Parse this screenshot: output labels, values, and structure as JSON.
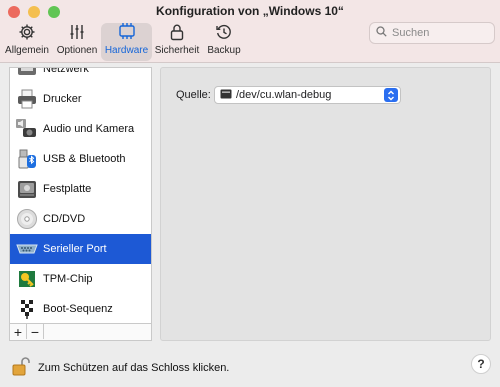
{
  "window": {
    "title": "Konfiguration von „Windows 10“",
    "traffic_colors": [
      "#ff5f57",
      "#febc2e",
      "#28c840"
    ]
  },
  "toolbar": {
    "items": [
      {
        "label": "Allgemein",
        "icon": "gear-icon"
      },
      {
        "label": "Optionen",
        "icon": "sliders-icon"
      },
      {
        "label": "Hardware",
        "icon": "hardware-chip-icon",
        "active": true
      },
      {
        "label": "Sicherheit",
        "icon": "lock-icon"
      },
      {
        "label": "Backup",
        "icon": "clock-history-icon"
      }
    ],
    "accent_color": "#1565d8"
  },
  "search": {
    "placeholder": "Suchen",
    "icon": "search-icon"
  },
  "sidebar": {
    "items": [
      {
        "label": "Netzwerk",
        "icon": "network-icon"
      },
      {
        "label": "Drucker",
        "icon": "printer-icon"
      },
      {
        "label": "Audio und Kamera",
        "icon": "audio-camera-icon"
      },
      {
        "label": "USB & Bluetooth",
        "icon": "usb-bluetooth-icon"
      },
      {
        "label": "Festplatte",
        "icon": "hard-disk-icon"
      },
      {
        "label": "CD/DVD",
        "icon": "cd-dvd-icon"
      },
      {
        "label": "Serieller Port",
        "icon": "serial-port-icon",
        "selected": true
      },
      {
        "label": "TPM-Chip",
        "icon": "tpm-chip-icon"
      },
      {
        "label": "Boot-Sequenz",
        "icon": "boot-sequence-icon"
      }
    ],
    "add_label": "+",
    "remove_label": "−",
    "selection_color": "#1d59d5"
  },
  "main": {
    "source_label": "Quelle:",
    "source_value": "/dev/cu.wlan-debug",
    "source_icon": "terminal-icon"
  },
  "footer": {
    "lock_text": "Zum Schützen auf das Schloss klicken.",
    "lock_icon": "open-lock-icon",
    "help_label": "?"
  }
}
